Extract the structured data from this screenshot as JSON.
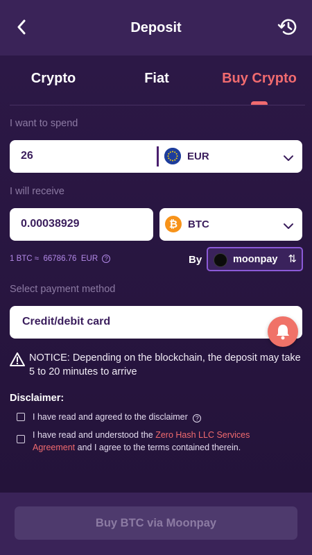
{
  "header": {
    "title": "Deposit"
  },
  "tabs": [
    {
      "label": "Crypto"
    },
    {
      "label": "Fiat"
    },
    {
      "label": "Buy Crypto"
    }
  ],
  "active_tab": "Buy Crypto",
  "spend": {
    "label": "I want to spend",
    "amount": "26",
    "currency": "EUR"
  },
  "receive": {
    "label": "I will receive",
    "amount": "0.00038929",
    "currency": "BTC"
  },
  "rate": {
    "text": "1 BTC ≈  66786.76  EUR"
  },
  "provider": {
    "by_label": "By",
    "name": "moonpay"
  },
  "payment": {
    "label": "Select payment method",
    "selected": "Credit/debit card"
  },
  "notice": {
    "text": "NOTICE: Depending on the blockchain, the deposit may take 5 to 20 minutes to arrive"
  },
  "disclaimer": {
    "title": "Disclaimer:",
    "item1": "I have read and agreed to the disclaimer",
    "item2_prefix": "I have read and understood the ",
    "item2_link": "Zero Hash LLC Services Agreement",
    "item2_suffix": " and I agree to the terms contained therein."
  },
  "cta": {
    "label": "Buy BTC via Moonpay"
  },
  "icons": {
    "back": "back-arrow-icon",
    "history": "history-icon",
    "eur": "eu-flag-icon",
    "btc": "bitcoin-icon",
    "dropdown": "chevron-down-icon",
    "info": "info-icon",
    "swap": "swap-icon",
    "bell": "bell-icon",
    "warning": "warning-icon"
  },
  "colors": {
    "background": "#2a1642",
    "header": "#3a2358",
    "accent": "#f16b6f",
    "brand_text": "#3a1d5c",
    "rate_text": "#b38ae8",
    "cta_disabled": "#4e3a6d"
  }
}
